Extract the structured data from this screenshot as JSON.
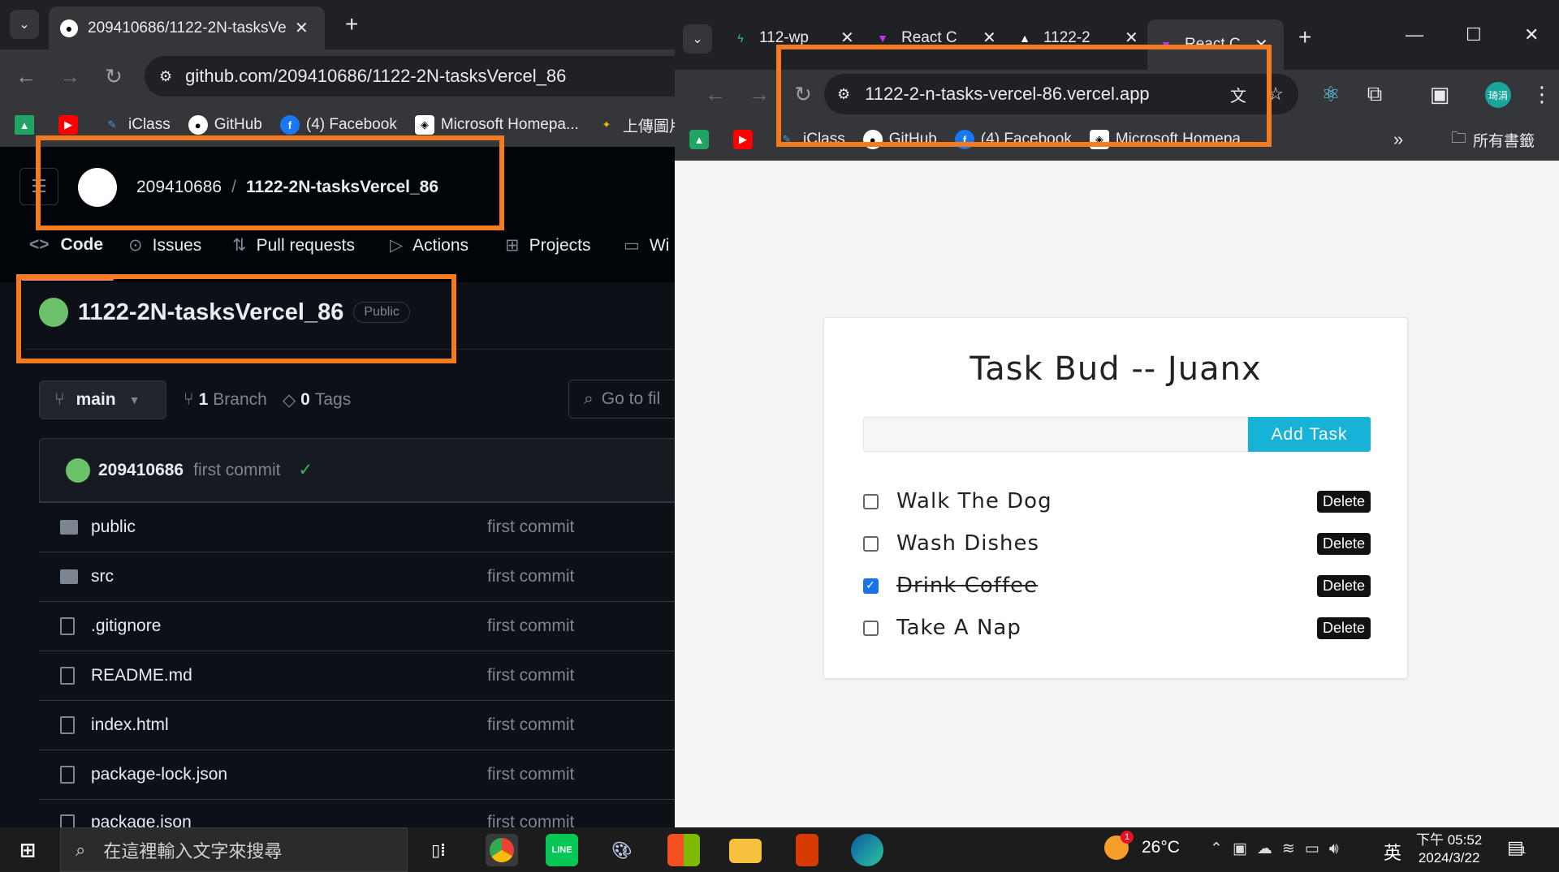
{
  "left_browser": {
    "tab_title": "209410686/1122-2N-tasksVe",
    "url": "github.com/209410686/1122-2N-tasksVercel_86",
    "bookmarks": [
      "iClass",
      "GitHub",
      "(4) Facebook",
      "Microsoft Homepa...",
      "上傳圖片"
    ]
  },
  "github": {
    "owner": "209410686",
    "separator": "/",
    "repo": "1122-2N-tasksVercel_86",
    "nav": [
      "Code",
      "Issues",
      "Pull requests",
      "Actions",
      "Projects",
      "Wi"
    ],
    "visibility": "Public",
    "branch": "main",
    "branch_count": "1",
    "branch_label": "Branch",
    "tag_count": "0",
    "tag_label": "Tags",
    "go_to_file": "Go to fil",
    "commit_author": "209410686",
    "commit_message": "first commit",
    "files": [
      {
        "name": "public",
        "type": "folder",
        "commit": "first commit"
      },
      {
        "name": "src",
        "type": "folder",
        "commit": "first commit"
      },
      {
        "name": ".gitignore",
        "type": "file",
        "commit": "first commit"
      },
      {
        "name": "README.md",
        "type": "file",
        "commit": "first commit"
      },
      {
        "name": "index.html",
        "type": "file",
        "commit": "first commit"
      },
      {
        "name": "package-lock.json",
        "type": "file",
        "commit": "first commit"
      },
      {
        "name": "package.json",
        "type": "file",
        "commit": "first commit"
      }
    ]
  },
  "right_browser": {
    "tabs": [
      "112-wp",
      "React C",
      "1122-2",
      "React C"
    ],
    "url": "1122-2-n-tasks-vercel-86.vercel.app",
    "bookmarks": [
      "iClass",
      "GitHub",
      "(4) Facebook",
      "Microsoft Homepa..."
    ],
    "all_bookmarks": "所有書籤",
    "profile": "琦涓"
  },
  "task_app": {
    "title": "Task Bud -- Juanx",
    "input_value": "",
    "add_button": "Add Task",
    "delete_label": "Delete",
    "tasks": [
      {
        "text": "Walk The Dog",
        "done": false
      },
      {
        "text": "Wash Dishes",
        "done": false
      },
      {
        "text": "Drink Coffee",
        "done": true
      },
      {
        "text": "Take A Nap",
        "done": false
      }
    ]
  },
  "taskbar": {
    "search_placeholder": "在這裡輸入文字來搜尋",
    "temperature": "26°C",
    "ime": "英",
    "time": "下午 05:52",
    "date": "2024/3/22",
    "notification_count": "1",
    "weather_badge": "1"
  },
  "colors": {
    "accent": "#f47b20",
    "add_button": "#17b3d6",
    "checkbox": "#1a73e8"
  }
}
